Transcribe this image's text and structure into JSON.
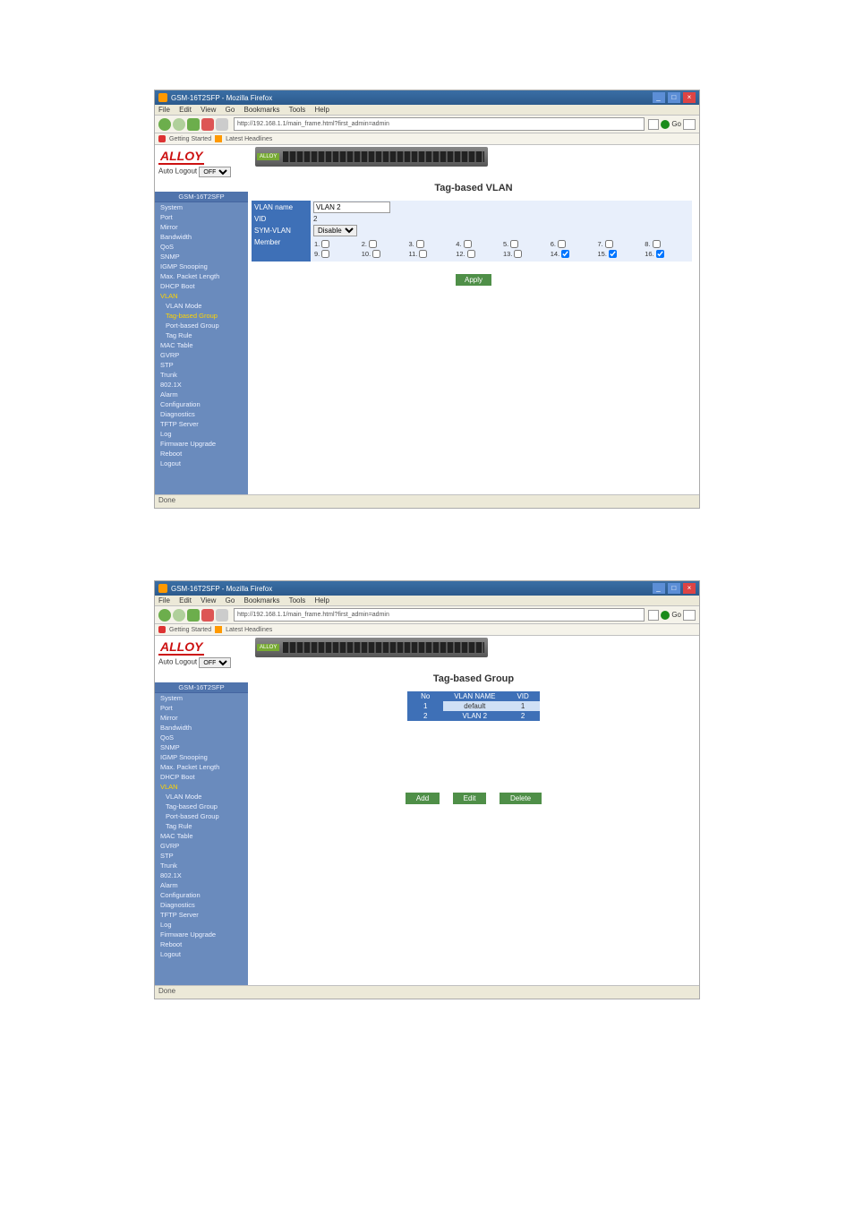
{
  "browser": {
    "title": "GSM-16T2SFP - Mozilla Firefox",
    "menu": [
      "File",
      "Edit",
      "View",
      "Go",
      "Bookmarks",
      "Tools",
      "Help"
    ],
    "url": "http://192.168.1.1/main_frame.html?first_admin=admin",
    "go_label": "Go",
    "bookmarks": [
      "Getting Started",
      "Latest Headlines"
    ],
    "status": "Done"
  },
  "brand": {
    "logo_text": "ALLOY",
    "auto_logout_label": "Auto Logout",
    "auto_logout_value": "OFF"
  },
  "sidebar": {
    "header": "GSM-16T2SFP",
    "items": [
      {
        "label": "System"
      },
      {
        "label": "Port"
      },
      {
        "label": "Mirror"
      },
      {
        "label": "Bandwidth"
      },
      {
        "label": "QoS"
      },
      {
        "label": "SNMP"
      },
      {
        "label": "IGMP Snooping"
      },
      {
        "label": "Max. Packet Length"
      },
      {
        "label": "DHCP Boot"
      },
      {
        "label": "VLAN",
        "yellowcat": true
      },
      {
        "label": "VLAN Mode",
        "sub": true
      },
      {
        "label": "Tag-based Group",
        "sub": true,
        "active_in": 1
      },
      {
        "label": "Port-based Group",
        "sub": true
      },
      {
        "label": "Tag Rule",
        "sub": true
      },
      {
        "label": "MAC Table"
      },
      {
        "label": "GVRP"
      },
      {
        "label": "STP"
      },
      {
        "label": "Trunk"
      },
      {
        "label": "802.1X"
      },
      {
        "label": "Alarm"
      },
      {
        "label": "Configuration"
      },
      {
        "label": "Diagnostics"
      },
      {
        "label": "TFTP Server"
      },
      {
        "label": "Log"
      },
      {
        "label": "Firmware Upgrade"
      },
      {
        "label": "Reboot"
      },
      {
        "label": "Logout"
      }
    ]
  },
  "screen1": {
    "title": "Tag-based VLAN",
    "rows": {
      "vlan_name": {
        "label": "VLAN name",
        "value": "VLAN 2"
      },
      "vid": {
        "label": "VID",
        "value": "2"
      },
      "sym_vlan": {
        "label": "SYM-VLAN",
        "value": "Disable"
      },
      "member": {
        "label": "Member"
      }
    },
    "members": [
      {
        "n": 1,
        "c": false
      },
      {
        "n": 2,
        "c": false
      },
      {
        "n": 3,
        "c": false
      },
      {
        "n": 4,
        "c": false
      },
      {
        "n": 5,
        "c": false
      },
      {
        "n": 6,
        "c": false
      },
      {
        "n": 7,
        "c": false
      },
      {
        "n": 8,
        "c": false
      },
      {
        "n": 9,
        "c": false
      },
      {
        "n": 10,
        "c": false
      },
      {
        "n": 11,
        "c": false
      },
      {
        "n": 12,
        "c": false
      },
      {
        "n": 13,
        "c": false
      },
      {
        "n": 14,
        "c": true
      },
      {
        "n": 15,
        "c": true
      },
      {
        "n": 16,
        "c": true
      }
    ],
    "apply": "Apply"
  },
  "screen2": {
    "title": "Tag-based Group",
    "columns": [
      "No",
      "VLAN NAME",
      "VID"
    ],
    "rows": [
      {
        "no": "1",
        "name": "default",
        "vid": "1",
        "selected": false
      },
      {
        "no": "2",
        "name": "VLAN 2",
        "vid": "2",
        "selected": true
      }
    ],
    "buttons": {
      "add": "Add",
      "edit": "Edit",
      "delete": "Delete"
    }
  }
}
